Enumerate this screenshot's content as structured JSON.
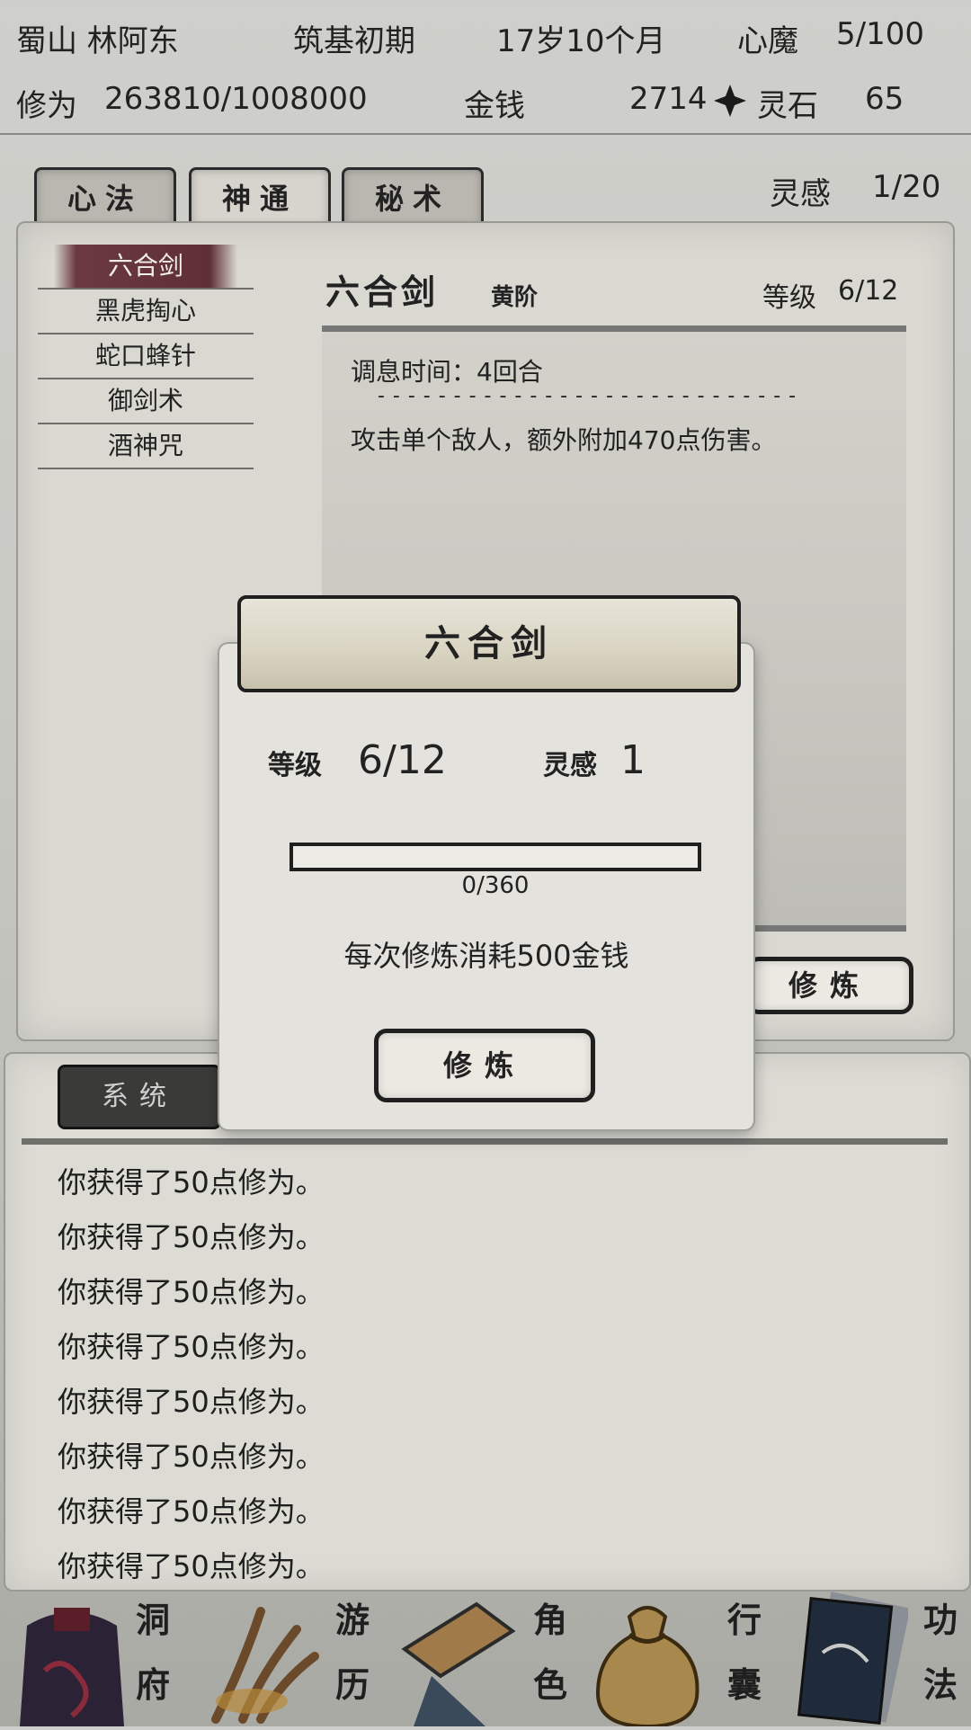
{
  "status": {
    "sect_name": "蜀山 林阿东",
    "realm": "筑基初期",
    "age": "17岁10个月",
    "demon_label": "心魔",
    "demon_value": "5/100",
    "cultivation_label": "修为",
    "cultivation_value": "263810/1008000",
    "money_label": "金钱",
    "money_value": "2714",
    "spirit_stone_label": "灵石",
    "spirit_stone_value": "65"
  },
  "tabs": [
    {
      "label": "心法",
      "active": false
    },
    {
      "label": "神通",
      "active": true
    },
    {
      "label": "秘术",
      "active": false
    }
  ],
  "inspiration": {
    "label": "灵感",
    "value": "1/20"
  },
  "skills": [
    {
      "name": "六合剑",
      "active": true
    },
    {
      "name": "黑虎掏心",
      "active": false
    },
    {
      "name": "蛇口蜂针",
      "active": false
    },
    {
      "name": "御剑术",
      "active": false
    },
    {
      "name": "酒神咒",
      "active": false
    }
  ],
  "detail": {
    "name": "六合剑",
    "grade": "黄阶",
    "level_label": "等级",
    "level_value": "6/12",
    "cooldown": "调息时间：4回合",
    "divider": "- - - - - - - - - - - - - - - - - - - - - - - - - - - -",
    "description": "攻击单个敌人，额外附加470点伤害。",
    "train_button": "修炼"
  },
  "log": {
    "tab_label": "系统",
    "lines": [
      "你获得了50点修为。",
      "你获得了50点修为。",
      "你获得了50点修为。",
      "你获得了50点修为。",
      "你获得了50点修为。",
      "你获得了50点修为。",
      "你获得了50点修为。",
      "你获得了50点修为。"
    ]
  },
  "modal": {
    "title": "六合剑",
    "level_label": "等级",
    "level_value": "6/12",
    "inspiration_label": "灵感",
    "inspiration_value": "1",
    "progress_text": "0/360",
    "progress_fraction": 0,
    "cost_text": "每次修炼消耗500金钱",
    "train_button": "修炼"
  },
  "nav": [
    {
      "top": "洞",
      "bottom": "府",
      "icon": "cave-dwelling-icon"
    },
    {
      "top": "游",
      "bottom": "历",
      "icon": "travel-icon"
    },
    {
      "top": "角",
      "bottom": "色",
      "icon": "character-icon"
    },
    {
      "top": "行",
      "bottom": "囊",
      "icon": "bag-icon"
    },
    {
      "top": "功",
      "bottom": "法",
      "icon": "technique-book-icon"
    }
  ],
  "colors": {
    "accent": "#6b3a40",
    "panel": "#d9d8d1",
    "ink": "#1f1f1f"
  }
}
